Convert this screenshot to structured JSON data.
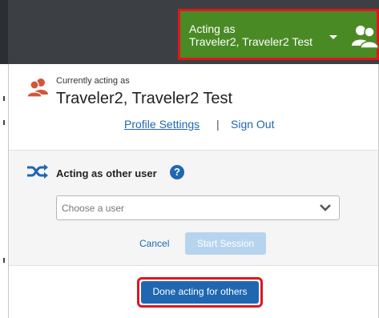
{
  "header": {
    "acting_as_line1": "Acting as",
    "acting_as_line2": "Traveler2, Traveler2 Test",
    "users_icon": "users-icon",
    "caret_icon": "caret-down-icon"
  },
  "profile": {
    "currently_label": "Currently acting as",
    "name": "Traveler2, Traveler2 Test",
    "profile_settings_link": "Profile Settings",
    "separator": "|",
    "sign_out_link": "Sign Out",
    "icon": "user-icon"
  },
  "acting_other": {
    "label": "Acting as other user",
    "help_glyph": "?",
    "icon": "shuffle-icon",
    "select_placeholder": "Choose a user",
    "cancel_label": "Cancel",
    "start_session_label": "Start Session"
  },
  "footer": {
    "done_label": "Done acting for others"
  },
  "colors": {
    "topbar": "#3c3f43",
    "accent_green": "#4a8a25",
    "highlight_red": "#e3141e",
    "primary_blue": "#1f67b1",
    "disabled_blue": "#b7d4ee",
    "user_icon_orange": "#d2563a"
  }
}
